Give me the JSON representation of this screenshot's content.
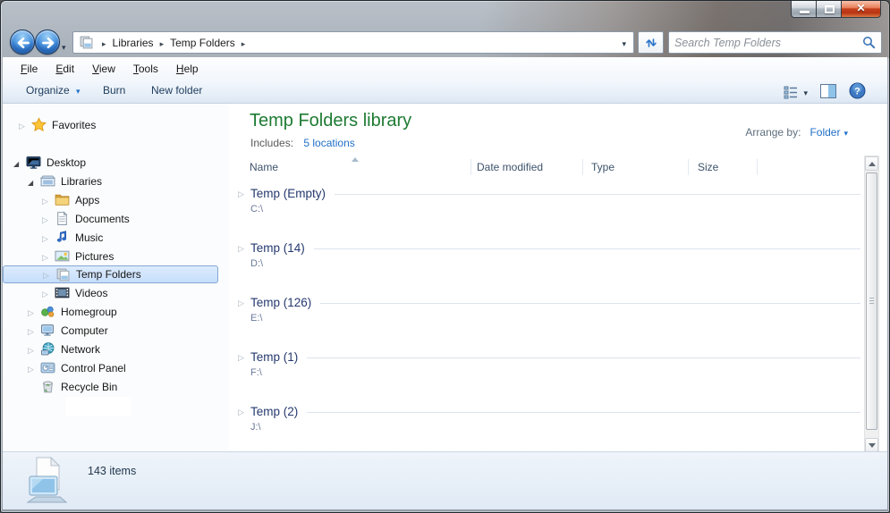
{
  "window": {
    "controls": {
      "minimize": "minimize",
      "maximize": "maximize",
      "close": "close"
    }
  },
  "address_bar": {
    "breadcrumb": {
      "segments": [
        "Libraries",
        "Temp Folders"
      ]
    },
    "search": {
      "placeholder": "Search Temp Folders"
    }
  },
  "menu_bar": {
    "items": [
      "File",
      "Edit",
      "View",
      "Tools",
      "Help"
    ]
  },
  "toolbar": {
    "organize_label": "Organize",
    "burn_label": "Burn",
    "new_folder_label": "New folder"
  },
  "sidebar": {
    "items": [
      {
        "label": "Favorites",
        "icon": "star",
        "state": "collapsed",
        "selected": false
      },
      {
        "label": "Desktop",
        "icon": "desktop",
        "state": "expanded",
        "selected": false
      },
      {
        "label": "Libraries",
        "icon": "libraries",
        "state": "expanded",
        "selected": false
      },
      {
        "label": "Apps",
        "icon": "folder",
        "state": "collapsed",
        "selected": false
      },
      {
        "label": "Documents",
        "icon": "documents",
        "state": "collapsed",
        "selected": false
      },
      {
        "label": "Music",
        "icon": "music",
        "state": "collapsed",
        "selected": false
      },
      {
        "label": "Pictures",
        "icon": "pictures",
        "state": "collapsed",
        "selected": false
      },
      {
        "label": "Temp Folders",
        "icon": "library",
        "state": "collapsed",
        "selected": true
      },
      {
        "label": "Videos",
        "icon": "videos",
        "state": "collapsed",
        "selected": false
      },
      {
        "label": "Homegroup",
        "icon": "homegroup",
        "state": "collapsed",
        "selected": false
      },
      {
        "label": "Computer",
        "icon": "computer",
        "state": "collapsed",
        "selected": false
      },
      {
        "label": "Network",
        "icon": "network",
        "state": "collapsed",
        "selected": false
      },
      {
        "label": "Control Panel",
        "icon": "control-panel",
        "state": "collapsed",
        "selected": false
      },
      {
        "label": "Recycle Bin",
        "icon": "recycle-bin",
        "state": "none",
        "selected": false
      }
    ]
  },
  "content": {
    "title": "Temp Folders library",
    "includes_label": "Includes:",
    "includes_link": "5 locations",
    "arrange_by_label": "Arrange by:",
    "arrange_by_value": "Folder",
    "columns": [
      "Name",
      "Date modified",
      "Type",
      "Size"
    ],
    "sort": {
      "column": "Name",
      "direction": "ascending"
    },
    "groups": [
      {
        "name": "Temp (Empty)",
        "path": "C:\\"
      },
      {
        "name": "Temp (14)",
        "path": "D:\\"
      },
      {
        "name": "Temp (126)",
        "path": "E:\\"
      },
      {
        "name": "Temp (1)",
        "path": "F:\\"
      },
      {
        "name": "Temp (2)",
        "path": "J:\\"
      }
    ]
  },
  "status_bar": {
    "text": "143 items"
  },
  "icons": {
    "search-icon": "magnifier",
    "refresh-icon": "sync-arrows",
    "back-icon": "arrow-left",
    "forward-icon": "arrow-right",
    "views-icon": "list-view",
    "preview-pane-icon": "split-panel",
    "help-icon": "question-circle"
  },
  "colors": {
    "title_green": "#1e7b33",
    "link_blue": "#2170c8",
    "selection_border": "#84a7d3",
    "close_button_red": "#c33f1c",
    "group_header_navy": "#25396e"
  }
}
